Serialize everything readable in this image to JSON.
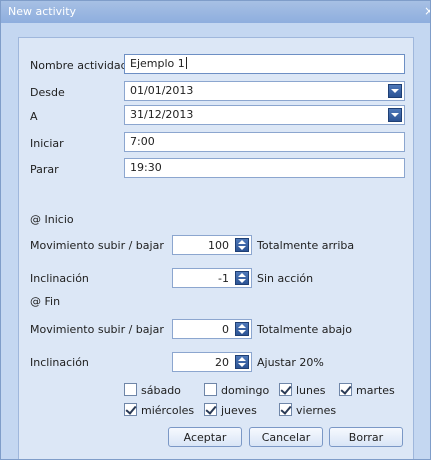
{
  "window": {
    "title": "New activity",
    "close_glyph": "×"
  },
  "form": {
    "name": {
      "label": "Nombre actividad",
      "value": "Ejemplo 1"
    },
    "desde": {
      "label": "Desde",
      "value": "01/01/2013"
    },
    "a": {
      "label": "A",
      "value": "31/12/2013"
    },
    "iniciar": {
      "label": "Iniciar",
      "value": "7:00"
    },
    "parar": {
      "label": "Parar",
      "value": "19:30"
    }
  },
  "inicio": {
    "header": "@ Inicio",
    "movement": {
      "label": "Movimiento subir / bajar",
      "value": "100",
      "description": "Totalmente arriba"
    },
    "tilt": {
      "label": "Inclinación",
      "value": "-1",
      "description": "Sin acción"
    }
  },
  "fin": {
    "header": "@ Fin",
    "movement": {
      "label": "Movimiento subir / bajar",
      "value": "0",
      "description": "Totalmente abajo"
    },
    "tilt": {
      "label": "Inclinación",
      "value": "20",
      "description": "Ajustar 20%"
    }
  },
  "days": {
    "sabado": {
      "label": "sábado",
      "checked": false
    },
    "domingo": {
      "label": "domingo",
      "checked": false
    },
    "lunes": {
      "label": "lunes",
      "checked": true
    },
    "martes": {
      "label": "martes",
      "checked": true
    },
    "miercoles": {
      "label": "miércoles",
      "checked": true
    },
    "jueves": {
      "label": "jueves",
      "checked": true
    },
    "viernes": {
      "label": "viernes",
      "checked": true
    }
  },
  "buttons": {
    "accept": "Aceptar",
    "cancel": "Cancelar",
    "delete": "Borrar"
  }
}
